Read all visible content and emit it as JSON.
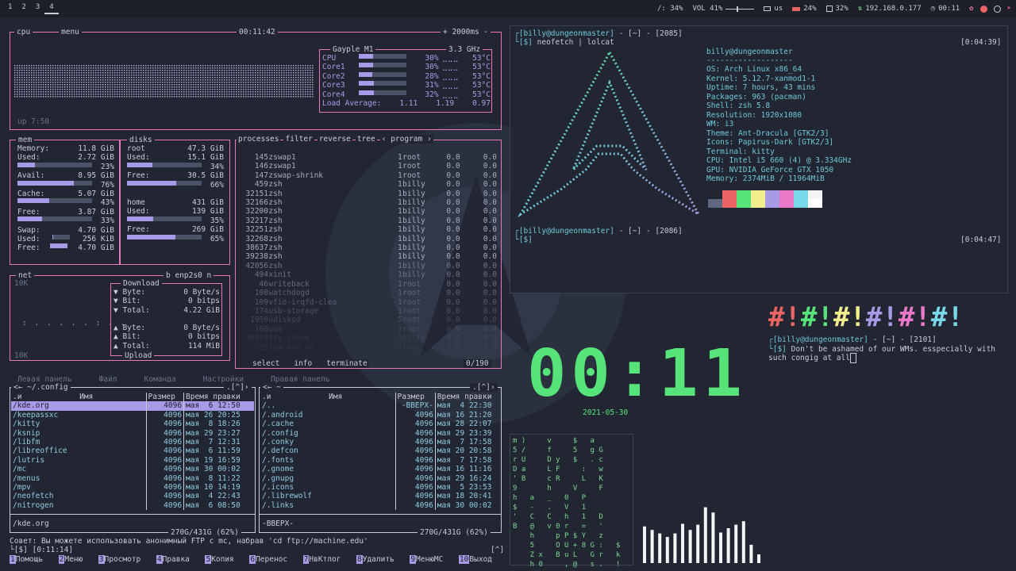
{
  "topbar": {
    "workspaces": [
      "1",
      "2",
      "3",
      "4"
    ],
    "active_workspace": "4",
    "brightness": "/: 34%",
    "volume": "VOL 41%",
    "keyboard": "us",
    "battery": "24%",
    "cpu": "32%",
    "ip": "192.168.0.177",
    "time": "00:11"
  },
  "cpu": {
    "title": "cpu",
    "menu": "menu",
    "clock": "00:11:42",
    "refresh": "+ 2000ms -",
    "uptime": "up  7:50",
    "model": "Gayple M1",
    "freq": "3.3 GHz",
    "cores": [
      {
        "name": "CPU",
        "pct": "30%",
        "temp": "53°C",
        "fill": 0.3
      },
      {
        "name": "Core1",
        "pct": "30%",
        "temp": "53°C",
        "fill": 0.3
      },
      {
        "name": "Core2",
        "pct": "28%",
        "temp": "53°C",
        "fill": 0.28
      },
      {
        "name": "Core3",
        "pct": "31%",
        "temp": "53°C",
        "fill": 0.31
      },
      {
        "name": "Core4",
        "pct": "32%",
        "temp": "53°C",
        "fill": 0.32
      }
    ],
    "load_label": "Load Average:",
    "load": [
      "1.11",
      "1.19",
      "0.97"
    ]
  },
  "mem": {
    "title": "mem",
    "rows": [
      {
        "k": "Memory:",
        "v": "11.8 GiB"
      },
      {
        "k": "Used:",
        "v": "2.72 GiB",
        "pct": "23%",
        "fill": 0.23
      },
      {
        "k": "Avail:",
        "v": "8.95 GiB",
        "pct": "76%",
        "fill": 0.76
      },
      {
        "k": "Cache:",
        "v": "5.07 GiB",
        "pct": "43%",
        "fill": 0.43
      },
      {
        "k": "Free:",
        "v": "3.87 GiB",
        "pct": "33%",
        "fill": 0.33
      },
      {
        "k": "Swap:",
        "v": "4.70 GiB"
      },
      {
        "k": "Used:",
        "v": "256 KiB"
      },
      {
        "k": "Free:",
        "v": "4.70 GiB"
      }
    ]
  },
  "disks": {
    "title": "disks",
    "root": {
      "name": "root",
      "size": "47.3 GiB",
      "used": "15.1 GiB",
      "used_pct": "34%",
      "used_fill": 0.34,
      "free": "30.5 GiB",
      "free_pct": "66%",
      "free_fill": 0.66
    },
    "home": {
      "name": "home",
      "size": "431 GiB",
      "used": "139 GiB",
      "used_pct": "35%",
      "used_fill": 0.35,
      "free": "269 GiB",
      "free_pct": "65%",
      "free_fill": 0.65
    },
    "used_label": "Used:",
    "free_label": "Free:"
  },
  "net": {
    "title": "net",
    "iface": "b enp2s0 n",
    "scale_top": "10K",
    "scale_bottom": "10K",
    "download": "Download",
    "upload": "Upload",
    "down_rows": [
      {
        "k": "▼ Byte:",
        "v": "0 Byte/s"
      },
      {
        "k": "▼ Bit:",
        "v": "0 bitps"
      },
      {
        "k": "▼ Total:",
        "v": "4.22 GiB"
      }
    ],
    "up_rows": [
      {
        "k": "▲ Byte:",
        "v": "0 Byte/s"
      },
      {
        "k": "▲ Bit:",
        "v": "0 bitps"
      },
      {
        "k": "▲ Total:",
        "v": "114 MiB"
      }
    ]
  },
  "proc": {
    "tabs": [
      "processes",
      "filter",
      "reverse",
      "tree",
      "‹ program ›"
    ],
    "headers": [
      "Pid:",
      "▼Program:",
      "Threads:",
      "User:",
      "Mem%",
      "Cpu%"
    ],
    "rows": [
      [
        "145",
        "zswap1",
        "1",
        "root",
        "0.0",
        "0.0"
      ],
      [
        "146",
        "zswap1",
        "1",
        "root",
        "0.0",
        "0.0"
      ],
      [
        "147",
        "zswap-shrink",
        "1",
        "root",
        "0.0",
        "0.0"
      ],
      [
        "459",
        "zsh",
        "1",
        "billy",
        "0.0",
        "0.0"
      ],
      [
        "32151",
        "zsh",
        "1",
        "billy",
        "0.0",
        "0.0"
      ],
      [
        "32166",
        "zsh",
        "1",
        "billy",
        "0.0",
        "0.0"
      ],
      [
        "32200",
        "zsh",
        "1",
        "billy",
        "0.0",
        "0.0"
      ],
      [
        "32217",
        "zsh",
        "1",
        "billy",
        "0.0",
        "0.0"
      ],
      [
        "32251",
        "zsh",
        "1",
        "billy",
        "0.0",
        "0.0"
      ],
      [
        "32268",
        "zsh",
        "1",
        "billy",
        "0.0",
        "0.0"
      ],
      [
        "38637",
        "zsh",
        "1",
        "billy",
        "0.0",
        "0.0"
      ],
      [
        "39238",
        "zsh",
        "1",
        "billy",
        "0.0",
        "0.0"
      ],
      [
        "42056",
        "zsh",
        "1",
        "billy",
        "0.0",
        "0.0"
      ],
      [
        "494",
        "xinit",
        "1",
        "billy",
        "0.0",
        "0.0"
      ],
      [
        "46",
        "writeback",
        "1",
        "root",
        "0.0",
        "0.0"
      ],
      [
        "108",
        "watchdogd",
        "1",
        "root",
        "0.0",
        "0.0"
      ],
      [
        "109",
        "vfio-irqfd-clea",
        "1",
        "root",
        "0.0",
        "0.0"
      ],
      [
        "174",
        "usb-storage",
        "1",
        "root",
        "0.0",
        "0.0"
      ],
      [
        "1950",
        "udisksd",
        "5",
        "root",
        "0.0",
        "0.0"
      ],
      [
        "160",
        "uas",
        "1",
        "root",
        "0.0",
        "0.0"
      ],
      [
        "38514",
        "tty-clock",
        "1",
        "billy",
        "0.0",
        "0.0"
      ],
      [
        "105",
        "tpm_dev_wq",
        "1",
        "root",
        "0.0",
        "0.0"
      ]
    ],
    "footer": [
      "select",
      "info",
      "terminate"
    ],
    "count": "0/190"
  },
  "neofetch": {
    "prompt_user": "billy",
    "prompt_host": "dungeonmaster",
    "prompt_dir": "~",
    "prompt_num": "2085",
    "prompt_num2": "2086",
    "cmd": "neofetch | lolcat",
    "time1": "[0:04:39]",
    "time2": "[0:04:47]",
    "title": "billy@dungeonmaster",
    "sep": "-------------------",
    "info": [
      "OS: Arch Linux x86_64",
      "Kernel: 5.12.7-xanmod1-1",
      "Uptime: 7 hours, 43 mins",
      "Packages: 963 (pacman)",
      "Shell: zsh 5.8",
      "Resolution: 1920x1080",
      "WM: i3",
      "Theme: Ant-Dracula [GTK2/3]",
      "Icons: Papirus-Dark [GTK2/3]",
      "Terminal: kitty",
      "CPU: Intel i5 660 (4) @ 3.334GHz",
      "GPU: NVIDIA GeForce GTX 1050",
      "Memory: 2374MiB / 11964MiB"
    ],
    "swatches": [
      "#22252f",
      "#ea6464",
      "#56e37a",
      "#f2ee8e",
      "#a79be8",
      "#ea78c9",
      "#79d8e8",
      "#f4f4f4"
    ],
    "swatches2": [
      "#5f6780",
      "#ea6464",
      "#56e37a",
      "#f2ee8e",
      "#a79be8",
      "#ea78c9",
      "#79d8e8",
      "#ffffff"
    ]
  },
  "clock": {
    "time": "00:11",
    "date": "2021-05-30"
  },
  "quote": {
    "banner": "#!#!#!#!#!#!",
    "prompt_user": "billy",
    "prompt_host": "dungeonmaster",
    "prompt_dir": "~",
    "prompt_num": "2101",
    "text": "Don't be ashamed of our WMs. esspecially with",
    "text2": "such congig at all"
  },
  "mc": {
    "menu": [
      "Левая панель",
      "Файл",
      "Команда",
      "Настройки",
      "Правая панель"
    ],
    "left_path": "~/.config",
    "right_path": "~",
    "col_n": ".и",
    "col_name": "Имя",
    "col_size": "Размер",
    "col_time": "Время правки",
    "left_rows": [
      [
        "/kde.org",
        "4096",
        "мая  6 12:50"
      ],
      [
        "/keepassxc",
        "4096",
        "мая 26 20:25"
      ],
      [
        "/kitty",
        "4096",
        "мая  8 18:26"
      ],
      [
        "/ksnip",
        "4096",
        "мая 29 23:27"
      ],
      [
        "/libfm",
        "4096",
        "мая  7 12:31"
      ],
      [
        "/libreoffice",
        "4096",
        "мая  6 11:59"
      ],
      [
        "/lutris",
        "4096",
        "мая 19 16:59"
      ],
      [
        "/mc",
        "4096",
        "мая 30 00:02"
      ],
      [
        "/menus",
        "4096",
        "мая  8 11:22"
      ],
      [
        "/mpv",
        "4096",
        "мая 10 14:19"
      ],
      [
        "/neofetch",
        "4096",
        "мая  4 22:43"
      ],
      [
        "/nitrogen",
        "4096",
        "мая  6 08:50"
      ]
    ],
    "right_rows": [
      [
        "/..",
        "-ВВЕРХ-",
        "мая  4 22:30"
      ],
      [
        "/.android",
        "4096",
        "мая 16 21:20"
      ],
      [
        "/.cache",
        "4096",
        "мая 28 22:07"
      ],
      [
        "/.config",
        "4096",
        "мая 29 23:39"
      ],
      [
        "/.conky",
        "4096",
        "мая  7 17:58"
      ],
      [
        "/.defcon",
        "4096",
        "мая 20 20:58"
      ],
      [
        "/.fonts",
        "4096",
        "мая  7 17:58"
      ],
      [
        "/.gnome",
        "4096",
        "мая 16 11:16"
      ],
      [
        "/.gnupg",
        "4096",
        "мая 29 16:24"
      ],
      [
        "/.icons",
        "4096",
        "мая  5 23:53"
      ],
      [
        "/.librewolf",
        "4096",
        "мая 18 20:41"
      ],
      [
        "/.links",
        "4096",
        "мая 30 00:02"
      ]
    ],
    "left_status": "/kde.org",
    "right_status": "-ВВЕРХ-",
    "disk": "270G/431G (62%)",
    "hint": "Совет: Вы можете использовать анонимный FTP с mc, набрав 'cd ftp://machine.edu'",
    "prompt": "[$] [0:11:14]",
    "fkeys": [
      {
        "n": "1",
        "l": "Помощь"
      },
      {
        "n": "2",
        "l": "Меню"
      },
      {
        "n": "3",
        "l": "Просмотр"
      },
      {
        "n": "4",
        "l": "Правка"
      },
      {
        "n": "5",
        "l": "Копия"
      },
      {
        "n": "6",
        "l": "Перенос"
      },
      {
        "n": "7",
        "l": "НвКтлог"
      },
      {
        "n": "8",
        "l": "Удалить"
      },
      {
        "n": "9",
        "l": "МенюМС"
      },
      {
        "n": "10",
        "l": "Выход"
      }
    ]
  },
  "visualizer": {
    "levels": [
      0.42,
      0.38,
      0.34,
      0.3,
      0.34,
      0.45,
      0.38,
      0.44,
      0.64,
      0.58,
      0.35,
      0.4,
      0.44,
      0.48,
      0.21,
      0.1
    ]
  }
}
